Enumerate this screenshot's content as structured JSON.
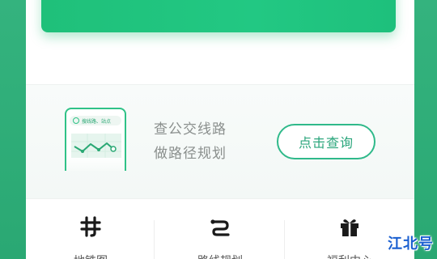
{
  "banner": {
    "color": "#22c883"
  },
  "route_card": {
    "search_hint": "搜线路、站点",
    "line1": "查公交线路",
    "line2": "做路径规划",
    "query_button": "点击查询",
    "accent_color": "#2fb98a"
  },
  "bottom_nav": {
    "items": [
      {
        "icon": "metro-icon",
        "label": "地铁图"
      },
      {
        "icon": "route-plan-icon",
        "label": "路线规划"
      },
      {
        "icon": "gift-icon",
        "label": "福利中心"
      }
    ]
  },
  "watermark": "江北号"
}
